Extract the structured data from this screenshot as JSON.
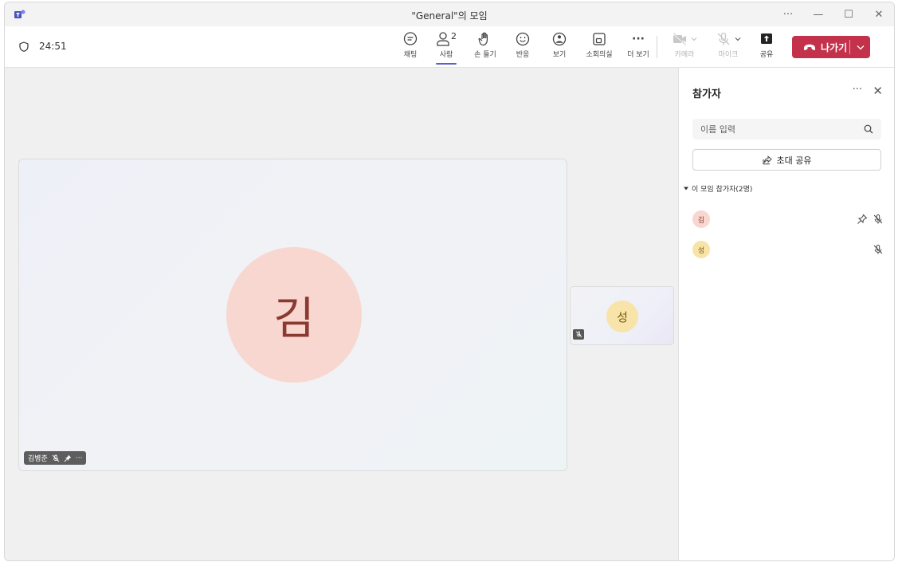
{
  "window": {
    "title": "\"General\"의 모임",
    "controls": {
      "more": "···",
      "minimize": "—",
      "maximize": "☐",
      "close": "✕"
    }
  },
  "toolbar": {
    "timer": "24:51",
    "items": [
      {
        "label": "채팅",
        "icon": "chat-icon"
      },
      {
        "label": "사람",
        "icon": "people-icon",
        "count": "2",
        "active": true
      },
      {
        "label": "손 들기",
        "icon": "raise-hand-icon"
      },
      {
        "label": "반응",
        "icon": "reaction-icon"
      },
      {
        "label": "보기",
        "icon": "view-icon"
      },
      {
        "label": "소회의실",
        "icon": "breakout-rooms-icon"
      },
      {
        "label": "더 보기",
        "icon": "more-icon",
        "glyph": "···"
      },
      {
        "label": "카메라",
        "icon": "camera-off-icon",
        "disabled": true
      },
      {
        "label": "마이크",
        "icon": "mic-off-icon",
        "disabled": true
      },
      {
        "label": "공유",
        "icon": "share-screen-icon"
      }
    ],
    "leave_label": "나가기"
  },
  "stage": {
    "main": {
      "initial": "김",
      "name": "김병준",
      "more": "···"
    },
    "secondary": {
      "initial": "성"
    }
  },
  "panel": {
    "title": "참가자",
    "more": "···",
    "close": "✕",
    "search_placeholder": "이름 입력",
    "invite_label": "초대 공유",
    "section_label": "이 모임 참가자(2명)",
    "participants": [
      {
        "initial": "김",
        "pinned": true,
        "muted": true
      },
      {
        "initial": "성",
        "pinned": false,
        "muted": true
      }
    ]
  },
  "colors": {
    "accent": "#5b5fc7",
    "leave": "#c4314b",
    "avatar_kim": "#f8d7d0",
    "avatar_seong": "#f8e3a8"
  }
}
